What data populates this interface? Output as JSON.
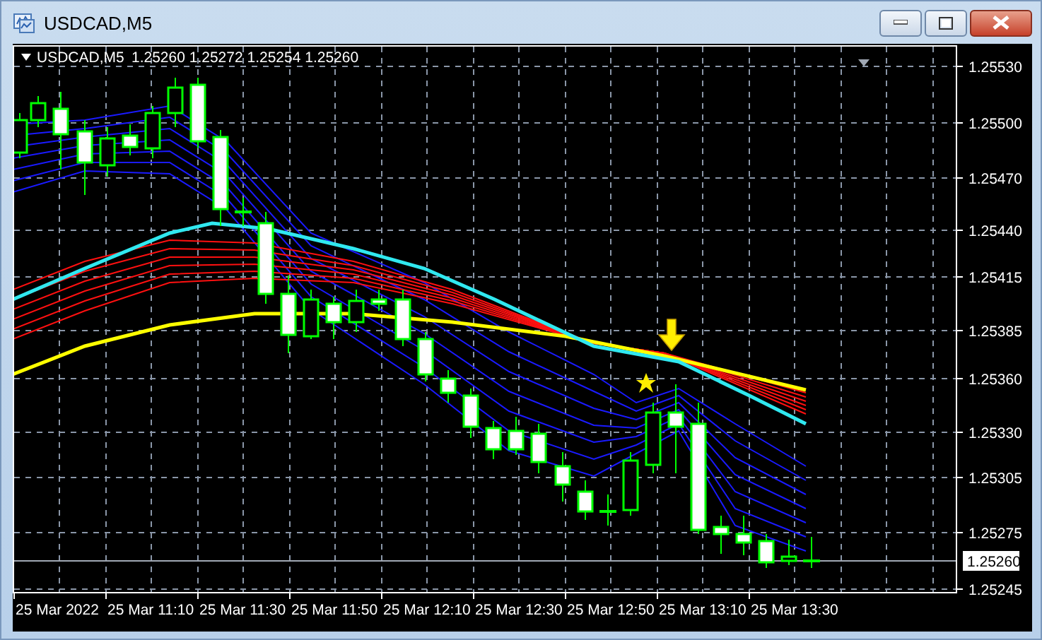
{
  "window": {
    "title": "USDCAD,M5"
  },
  "chart": {
    "symbol": "USDCAD,M5",
    "quote": "1.25260 1.25272 1.25254 1.25260",
    "price_ticks": [
      "1.25530",
      "1.25500",
      "1.25470",
      "1.25440",
      "1.25415",
      "1.25385",
      "1.25360",
      "1.25330",
      "1.25305",
      "1.25275",
      "1.25245"
    ],
    "current_price": "1.25260",
    "time_ticks": [
      "25 Mar 2022",
      "25 Mar 11:10",
      "25 Mar 11:30",
      "25 Mar 11:50",
      "25 Mar 12:10",
      "25 Mar 12:30",
      "25 Mar 12:50",
      "25 Mar 13:10",
      "25 Mar 13:30"
    ]
  }
}
